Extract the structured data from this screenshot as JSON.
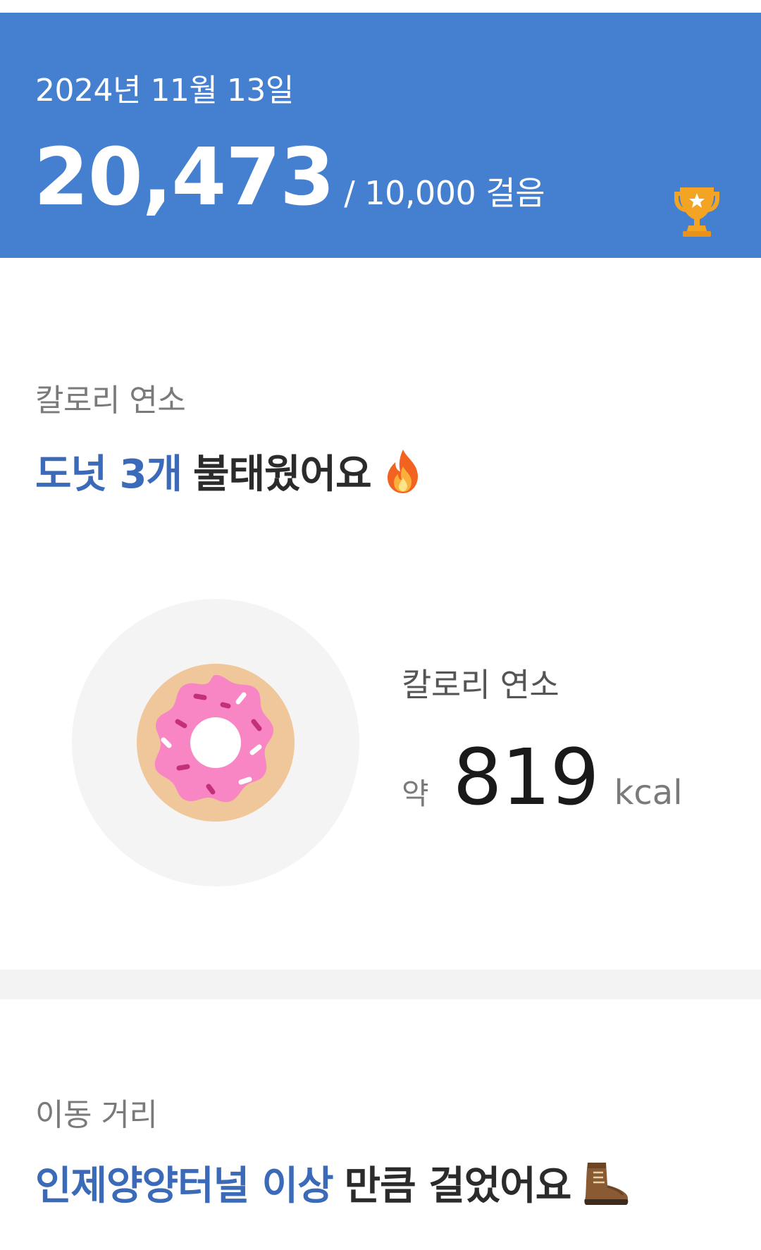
{
  "header": {
    "date": "2024년 11월 13일",
    "steps": "20,473",
    "goal": "/ 10,000 걸음",
    "accent_color": "#4580d0",
    "badge_icon": "trophy-icon"
  },
  "calories": {
    "section_label": "칼로리 연소",
    "headline_accent": "도넛 3개",
    "headline_rest": "불태웠어요",
    "headline_icon": "fire-icon",
    "card_label": "칼로리 연소",
    "prefix": "약",
    "value": "819",
    "unit": "kcal",
    "illustration_icon": "donut-icon"
  },
  "distance": {
    "section_label": "이동 거리",
    "headline_accent": "인제양양터널 이상",
    "headline_rest": "만큼 걸었어요",
    "headline_icon": "boot-icon"
  }
}
